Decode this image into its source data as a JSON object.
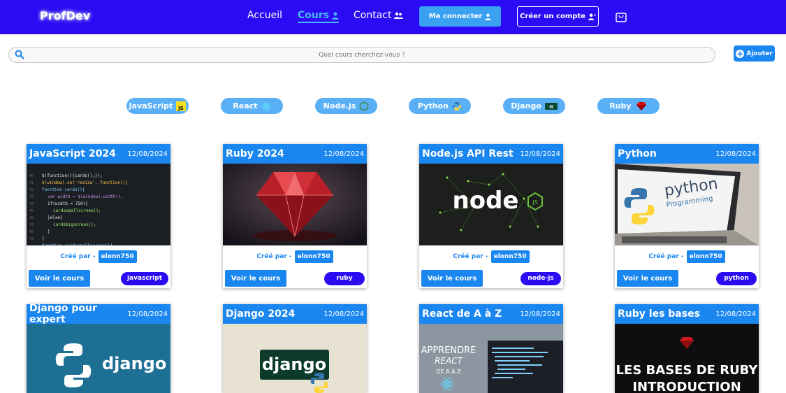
{
  "brand": "ProfDev",
  "nav": {
    "home": "Accueil",
    "courses": "Cours",
    "contact": "Contact",
    "login": "Me connecter",
    "register": "Créer un compte"
  },
  "search": {
    "placeholder": "Quel cours cherchez-vous ?"
  },
  "add_button": "Ajouter",
  "filters": [
    {
      "label": "JavaScript",
      "icon": "js-icon"
    },
    {
      "label": "React",
      "icon": "react-icon"
    },
    {
      "label": "Node.js",
      "icon": "nodejs-icon"
    },
    {
      "label": "Python",
      "icon": "python-icon"
    },
    {
      "label": "Django",
      "icon": "django-icon"
    },
    {
      "label": "Ruby",
      "icon": "ruby-icon"
    }
  ],
  "courses": [
    {
      "title": "JavaScript 2024",
      "date": "12/08/2024",
      "by": "Créé par -",
      "author": "elonn750",
      "view": "Voir le cours",
      "tag": "javascript",
      "image": "code-editor-image"
    },
    {
      "title": "Ruby 2024",
      "date": "12/08/2024",
      "by": "Créé par -",
      "author": "elonn750",
      "view": "Voir le cours",
      "tag": "ruby",
      "image": "ruby-gem-image"
    },
    {
      "title": "Node.js API Rest",
      "date": "12/08/2024",
      "by": "Créé par -",
      "author": "elonn750",
      "view": "Voir le cours",
      "tag": "node-js",
      "image": "nodejs-logo-image"
    },
    {
      "title": "Python",
      "date": "12/08/2024",
      "by": "Créé par -",
      "author": "elonn750",
      "view": "Voir le cours",
      "tag": "python",
      "image": "python-laptop-image",
      "image_text": [
        "python",
        "Programming"
      ]
    },
    {
      "title": "Django pour expert",
      "date": "12/08/2024",
      "image": "django-python-image",
      "image_text": "django"
    },
    {
      "title": "Django 2024",
      "date": "12/08/2024",
      "image": "django-logo-image",
      "image_text": "django"
    },
    {
      "title": "React de A à Z",
      "date": "12/08/2024",
      "image": "react-course-image",
      "image_text": [
        "APPRENDRE",
        "REACT",
        "DE A À Z"
      ]
    },
    {
      "title": "Ruby les bases",
      "date": "12/08/2024",
      "image": "ruby-basics-image",
      "image_text": [
        "LES BASES DE RUBY",
        "INTRODUCTION"
      ]
    }
  ],
  "code_lines": [
    "$(function(){cards();});",
    "$(window).on('resize', function(){",
    "function cards(){",
    "  var width = $(window).width();",
    "  if(width < 750){",
    "    cardssmallscreen();",
    "  }else{",
    "    cardsbigscreen();",
    "  }",
    "}",
    "function cardssmallscreen(){"
  ],
  "colors": {
    "header": "#2a0bf3",
    "accent": "#1a86f0",
    "chip": "#5ab0f7",
    "tag": "#2a0bf3"
  }
}
